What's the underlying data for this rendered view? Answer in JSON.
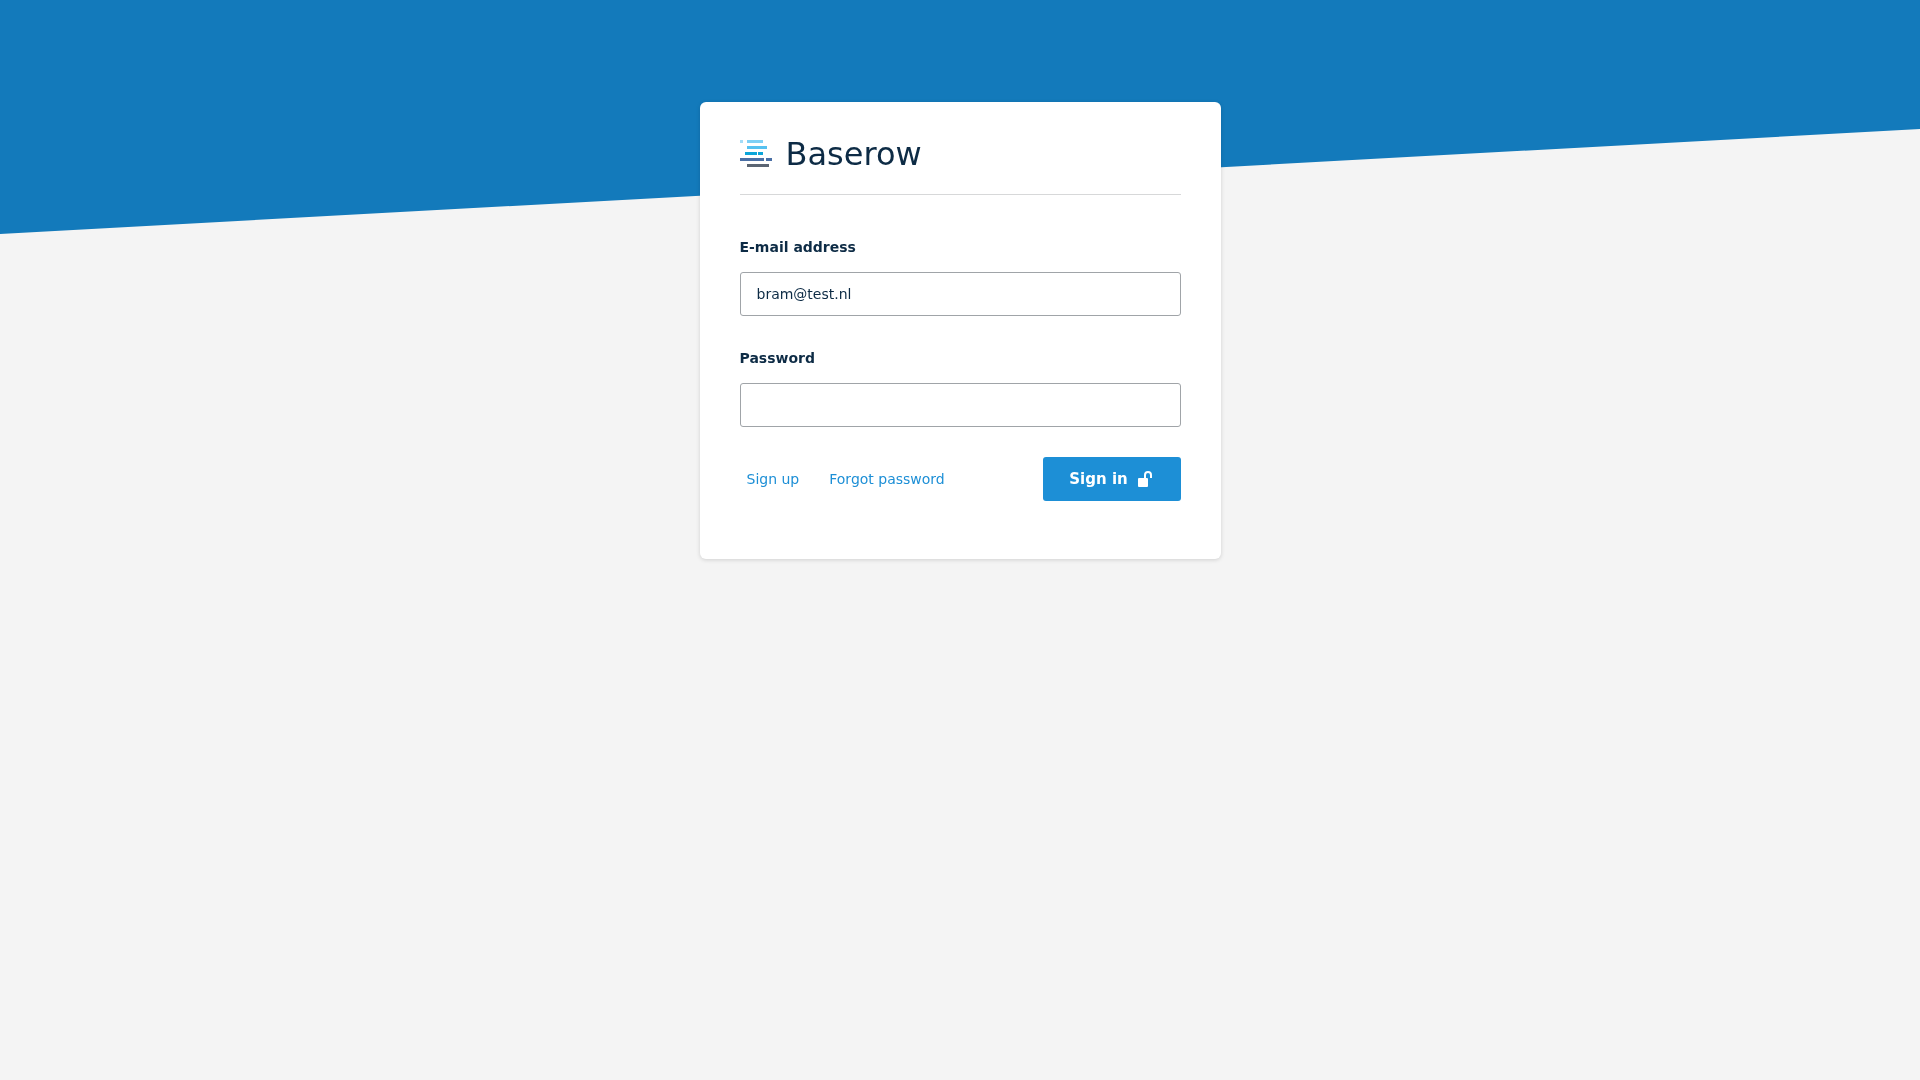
{
  "logo": {
    "text": "Baserow"
  },
  "form": {
    "fields": [
      {
        "label": "E-mail address",
        "value": "bram@test.nl",
        "kind": "email"
      },
      {
        "label": "Password",
        "kind": "password"
      }
    ],
    "links": [
      "Sign up",
      "Forgot password"
    ],
    "submit": "Sign in"
  }
}
